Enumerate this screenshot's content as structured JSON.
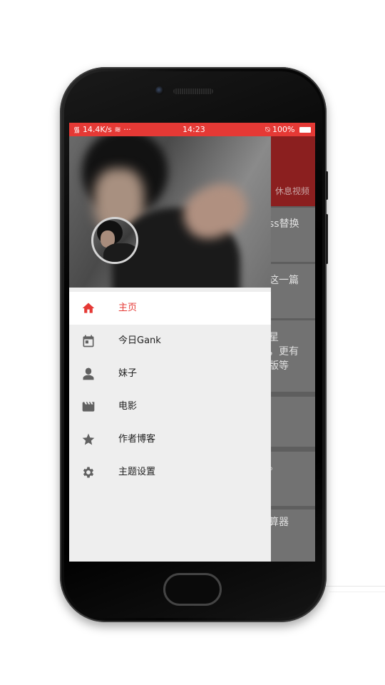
{
  "status_bar": {
    "network_speed": "14.4K/s",
    "time": "14:23",
    "battery": "100%"
  },
  "background_page": {
    "tab_label": "休息视频",
    "cards": [
      "ss替换",
      "这一篇",
      "星\n，更有\n版等",
      "",
      "。",
      "算器"
    ]
  },
  "drawer": {
    "menu": [
      {
        "label": "主页",
        "icon": "home-icon",
        "active": true
      },
      {
        "label": "今日Gank",
        "icon": "calendar-icon",
        "active": false
      },
      {
        "label": "妹子",
        "icon": "person-icon",
        "active": false
      },
      {
        "label": "电影",
        "icon": "movie-icon",
        "active": false
      },
      {
        "label": "作者博客",
        "icon": "star-icon",
        "active": false
      },
      {
        "label": "主题设置",
        "icon": "settings-icon",
        "active": false
      }
    ]
  },
  "colors": {
    "accent": "#e53935",
    "drawer_bg": "#eeeeee",
    "icon": "#616161"
  }
}
